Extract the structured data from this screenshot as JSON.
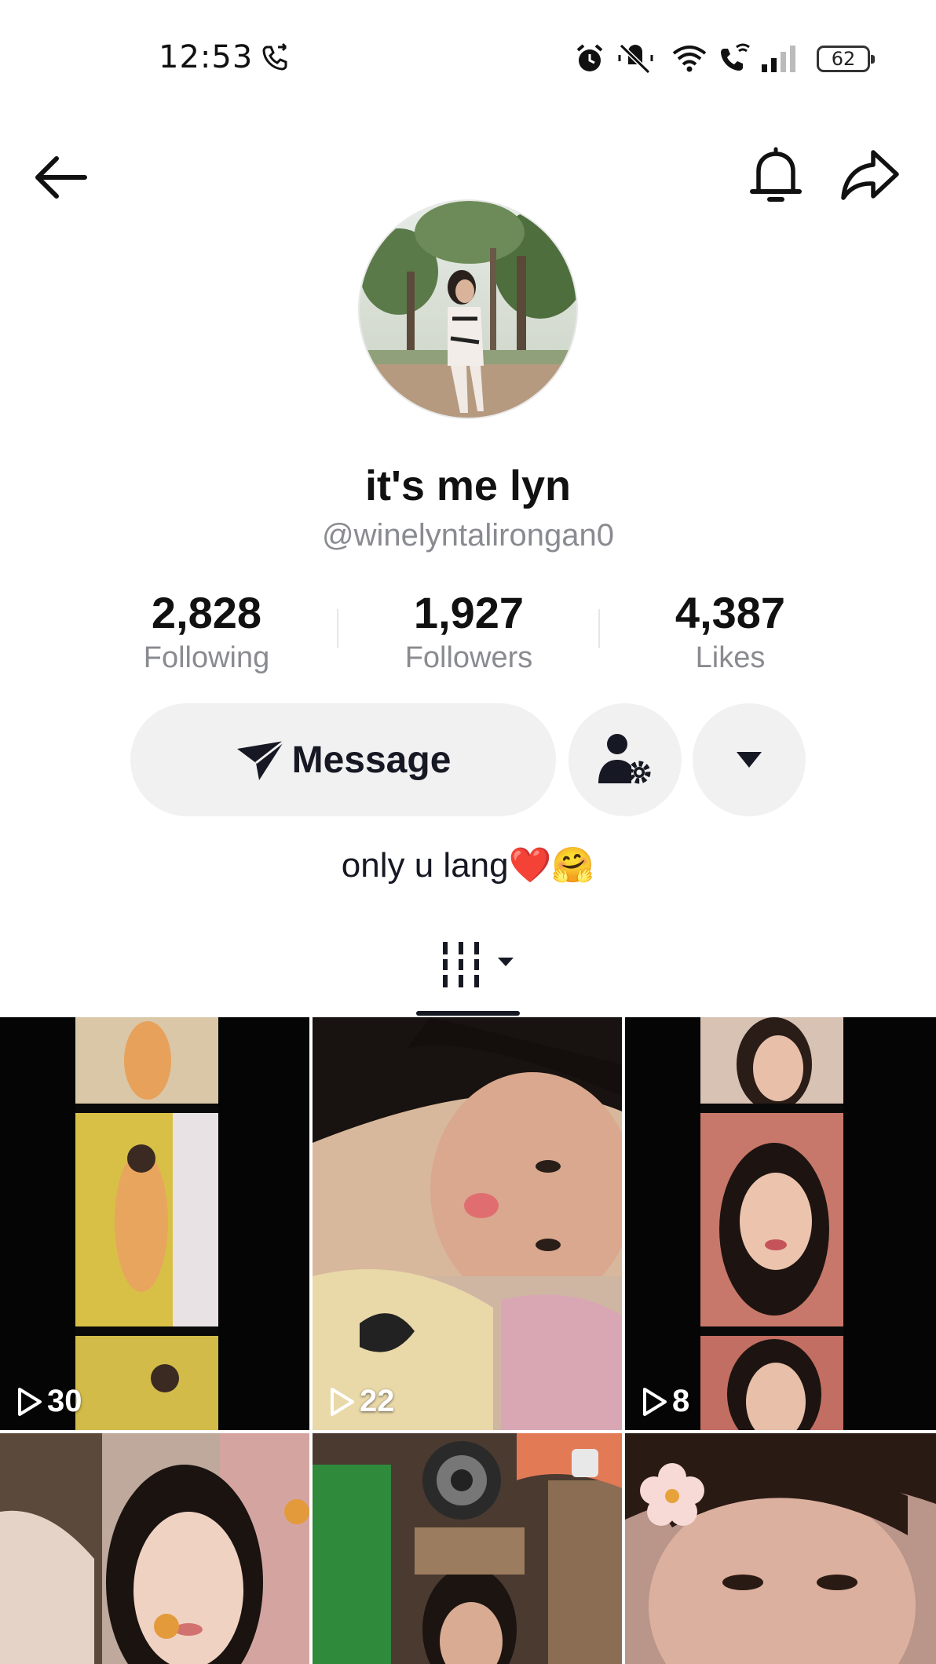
{
  "status_bar": {
    "time": "12:53",
    "battery": "62",
    "icons": [
      "call-forward-icon",
      "alarm-icon",
      "mute-icon",
      "wifi-icon",
      "wifi-call-icon",
      "signal-icon",
      "battery-icon"
    ]
  },
  "nav": {
    "back_icon": "back-arrow-icon",
    "bell_icon": "bell-icon",
    "share_icon": "share-icon"
  },
  "profile": {
    "display_name": "it's me lyn",
    "username": "@winelyntalirongan0",
    "bio_text": "only u lang",
    "bio_emoji": "❤️🤗"
  },
  "stats": [
    {
      "value": "2,828",
      "label": "Following"
    },
    {
      "value": "1,927",
      "label": "Followers"
    },
    {
      "value": "4,387",
      "label": "Likes"
    }
  ],
  "actions": {
    "message_label": "Message",
    "friend_settings_icon": "user-gear-icon",
    "more_icon": "caret-down-icon"
  },
  "tabs": {
    "videos_icon": "videos-grid-icon"
  },
  "videos": [
    {
      "views": "30"
    },
    {
      "views": "22"
    },
    {
      "views": "8"
    },
    {
      "views": ""
    },
    {
      "views": ""
    },
    {
      "views": ""
    }
  ],
  "colors": {
    "text_primary": "#161823",
    "text_secondary": "#8a8b91",
    "button_bg": "#f1f1f2",
    "heart": "#e02b3c"
  }
}
